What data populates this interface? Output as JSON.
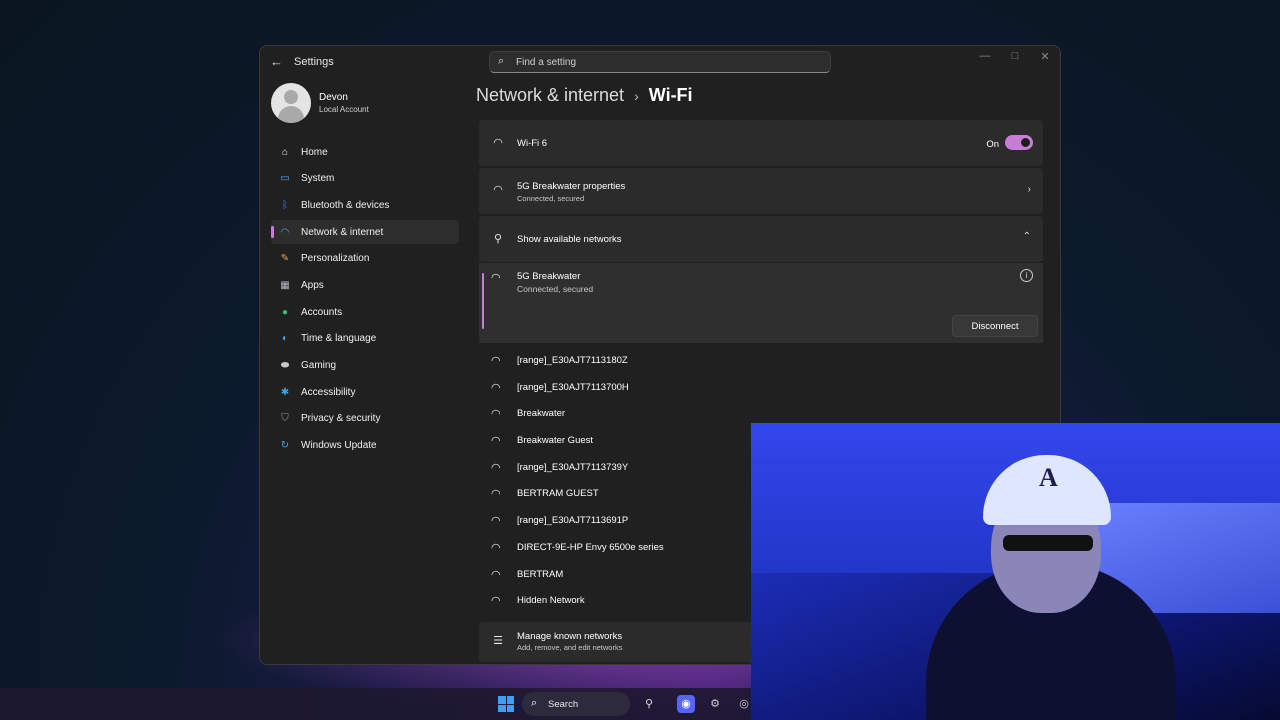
{
  "window": {
    "app_title": "Settings",
    "minimize": "—",
    "maximize": "□",
    "close": "✕"
  },
  "search": {
    "placeholder": "Find a setting"
  },
  "user": {
    "name": "Devon",
    "account_type": "Local Account"
  },
  "sidebar": {
    "items": [
      {
        "label": "Home",
        "icon": "home-icon",
        "color": "#f2f2f2"
      },
      {
        "label": "System",
        "icon": "display-icon",
        "color": "#4aa8ff"
      },
      {
        "label": "Bluetooth & devices",
        "icon": "bluetooth-icon",
        "color": "#3f7df5"
      },
      {
        "label": "Network & internet",
        "icon": "wifi-icon",
        "color": "#4aa8ff",
        "active": true
      },
      {
        "label": "Personalization",
        "icon": "brush-icon",
        "color": "#f0a050"
      },
      {
        "label": "Apps",
        "icon": "apps-icon",
        "color": "#b9b9c9"
      },
      {
        "label": "Accounts",
        "icon": "person-icon",
        "color": "#35c07a"
      },
      {
        "label": "Time & language",
        "icon": "globe-icon",
        "color": "#3fa4e8"
      },
      {
        "label": "Gaming",
        "icon": "gamepad-icon",
        "color": "#c8c8c8"
      },
      {
        "label": "Accessibility",
        "icon": "accessibility-icon",
        "color": "#3fa4e8"
      },
      {
        "label": "Privacy & security",
        "icon": "shield-icon",
        "color": "#9a9a9a"
      },
      {
        "label": "Windows Update",
        "icon": "update-icon",
        "color": "#3fa4e8"
      }
    ]
  },
  "breadcrumb": {
    "root": "Network & internet",
    "separator": "›",
    "leaf": "Wi-Fi"
  },
  "main": {
    "wifi_toggle": {
      "label": "Wi-Fi 6",
      "state_label": "On",
      "enabled": true
    },
    "properties": {
      "title": "5G Breakwater properties",
      "subtitle": "Connected, secured"
    },
    "show_networks": {
      "label": "Show available networks"
    },
    "connected": {
      "name": "5G Breakwater",
      "status": "Connected, secured",
      "action": "Disconnect"
    },
    "networks": [
      "[range]_E30AJT7113180Z",
      "[range]_E30AJT7113700H",
      "Breakwater",
      "Breakwater Guest",
      "[range]_E30AJT7113739Y",
      "BERTRAM GUEST",
      "[range]_E30AJT7113691P",
      "DIRECT-9E-HP Envy 6500e series",
      "BERTRAM",
      "Hidden Network"
    ],
    "manage": {
      "title": "Manage known networks",
      "subtitle": "Add, remove, and edit networks"
    }
  },
  "taskbar": {
    "search_label": "Search"
  },
  "colors": {
    "accent": "#c77dd6",
    "window_bg": "#202020",
    "card_bg": "#2b2b2b"
  }
}
